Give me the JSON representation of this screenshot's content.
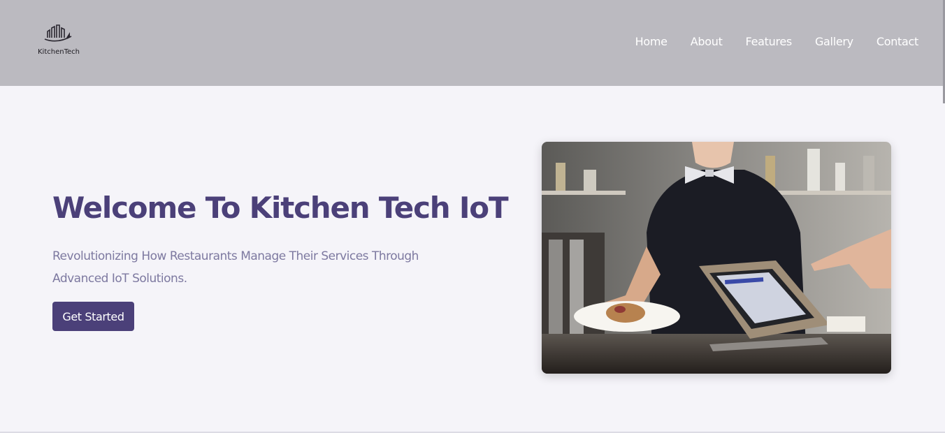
{
  "brand": {
    "name": "KitchenTech",
    "logo_icon": "city-skyline-icon"
  },
  "nav": {
    "items": [
      "Home",
      "About",
      "Features",
      "Gallery",
      "Contact"
    ]
  },
  "hero": {
    "title": "Welcome To Kitchen Tech IoT",
    "subtitle": "Revolutionizing How Restaurants Manage Their Services Through Advanced IoT Solutions.",
    "cta_label": "Get Started"
  },
  "colors": {
    "header_bg": "#bbbac0",
    "page_bg": "#f5f4f9",
    "accent": "#4b4079",
    "subtitle_text": "#7d79a0"
  }
}
